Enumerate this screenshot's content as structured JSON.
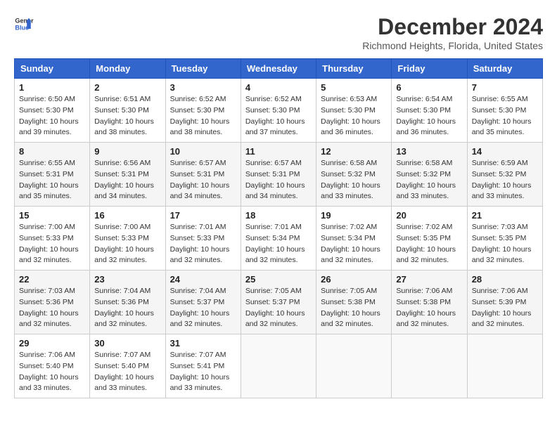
{
  "header": {
    "logo_line1": "General",
    "logo_line2": "Blue",
    "month_title": "December 2024",
    "location": "Richmond Heights, Florida, United States"
  },
  "weekdays": [
    "Sunday",
    "Monday",
    "Tuesday",
    "Wednesday",
    "Thursday",
    "Friday",
    "Saturday"
  ],
  "weeks": [
    [
      {
        "day": 1,
        "sunrise": "6:50 AM",
        "sunset": "5:30 PM",
        "daylight": "10 hours and 39 minutes."
      },
      {
        "day": 2,
        "sunrise": "6:51 AM",
        "sunset": "5:30 PM",
        "daylight": "10 hours and 38 minutes."
      },
      {
        "day": 3,
        "sunrise": "6:52 AM",
        "sunset": "5:30 PM",
        "daylight": "10 hours and 38 minutes."
      },
      {
        "day": 4,
        "sunrise": "6:52 AM",
        "sunset": "5:30 PM",
        "daylight": "10 hours and 37 minutes."
      },
      {
        "day": 5,
        "sunrise": "6:53 AM",
        "sunset": "5:30 PM",
        "daylight": "10 hours and 36 minutes."
      },
      {
        "day": 6,
        "sunrise": "6:54 AM",
        "sunset": "5:30 PM",
        "daylight": "10 hours and 36 minutes."
      },
      {
        "day": 7,
        "sunrise": "6:55 AM",
        "sunset": "5:30 PM",
        "daylight": "10 hours and 35 minutes."
      }
    ],
    [
      {
        "day": 8,
        "sunrise": "6:55 AM",
        "sunset": "5:31 PM",
        "daylight": "10 hours and 35 minutes."
      },
      {
        "day": 9,
        "sunrise": "6:56 AM",
        "sunset": "5:31 PM",
        "daylight": "10 hours and 34 minutes."
      },
      {
        "day": 10,
        "sunrise": "6:57 AM",
        "sunset": "5:31 PM",
        "daylight": "10 hours and 34 minutes."
      },
      {
        "day": 11,
        "sunrise": "6:57 AM",
        "sunset": "5:31 PM",
        "daylight": "10 hours and 34 minutes."
      },
      {
        "day": 12,
        "sunrise": "6:58 AM",
        "sunset": "5:32 PM",
        "daylight": "10 hours and 33 minutes."
      },
      {
        "day": 13,
        "sunrise": "6:58 AM",
        "sunset": "5:32 PM",
        "daylight": "10 hours and 33 minutes."
      },
      {
        "day": 14,
        "sunrise": "6:59 AM",
        "sunset": "5:32 PM",
        "daylight": "10 hours and 33 minutes."
      }
    ],
    [
      {
        "day": 15,
        "sunrise": "7:00 AM",
        "sunset": "5:33 PM",
        "daylight": "10 hours and 32 minutes."
      },
      {
        "day": 16,
        "sunrise": "7:00 AM",
        "sunset": "5:33 PM",
        "daylight": "10 hours and 32 minutes."
      },
      {
        "day": 17,
        "sunrise": "7:01 AM",
        "sunset": "5:33 PM",
        "daylight": "10 hours and 32 minutes."
      },
      {
        "day": 18,
        "sunrise": "7:01 AM",
        "sunset": "5:34 PM",
        "daylight": "10 hours and 32 minutes."
      },
      {
        "day": 19,
        "sunrise": "7:02 AM",
        "sunset": "5:34 PM",
        "daylight": "10 hours and 32 minutes."
      },
      {
        "day": 20,
        "sunrise": "7:02 AM",
        "sunset": "5:35 PM",
        "daylight": "10 hours and 32 minutes."
      },
      {
        "day": 21,
        "sunrise": "7:03 AM",
        "sunset": "5:35 PM",
        "daylight": "10 hours and 32 minutes."
      }
    ],
    [
      {
        "day": 22,
        "sunrise": "7:03 AM",
        "sunset": "5:36 PM",
        "daylight": "10 hours and 32 minutes."
      },
      {
        "day": 23,
        "sunrise": "7:04 AM",
        "sunset": "5:36 PM",
        "daylight": "10 hours and 32 minutes."
      },
      {
        "day": 24,
        "sunrise": "7:04 AM",
        "sunset": "5:37 PM",
        "daylight": "10 hours and 32 minutes."
      },
      {
        "day": 25,
        "sunrise": "7:05 AM",
        "sunset": "5:37 PM",
        "daylight": "10 hours and 32 minutes."
      },
      {
        "day": 26,
        "sunrise": "7:05 AM",
        "sunset": "5:38 PM",
        "daylight": "10 hours and 32 minutes."
      },
      {
        "day": 27,
        "sunrise": "7:06 AM",
        "sunset": "5:38 PM",
        "daylight": "10 hours and 32 minutes."
      },
      {
        "day": 28,
        "sunrise": "7:06 AM",
        "sunset": "5:39 PM",
        "daylight": "10 hours and 32 minutes."
      }
    ],
    [
      {
        "day": 29,
        "sunrise": "7:06 AM",
        "sunset": "5:40 PM",
        "daylight": "10 hours and 33 minutes."
      },
      {
        "day": 30,
        "sunrise": "7:07 AM",
        "sunset": "5:40 PM",
        "daylight": "10 hours and 33 minutes."
      },
      {
        "day": 31,
        "sunrise": "7:07 AM",
        "sunset": "5:41 PM",
        "daylight": "10 hours and 33 minutes."
      },
      null,
      null,
      null,
      null
    ]
  ]
}
